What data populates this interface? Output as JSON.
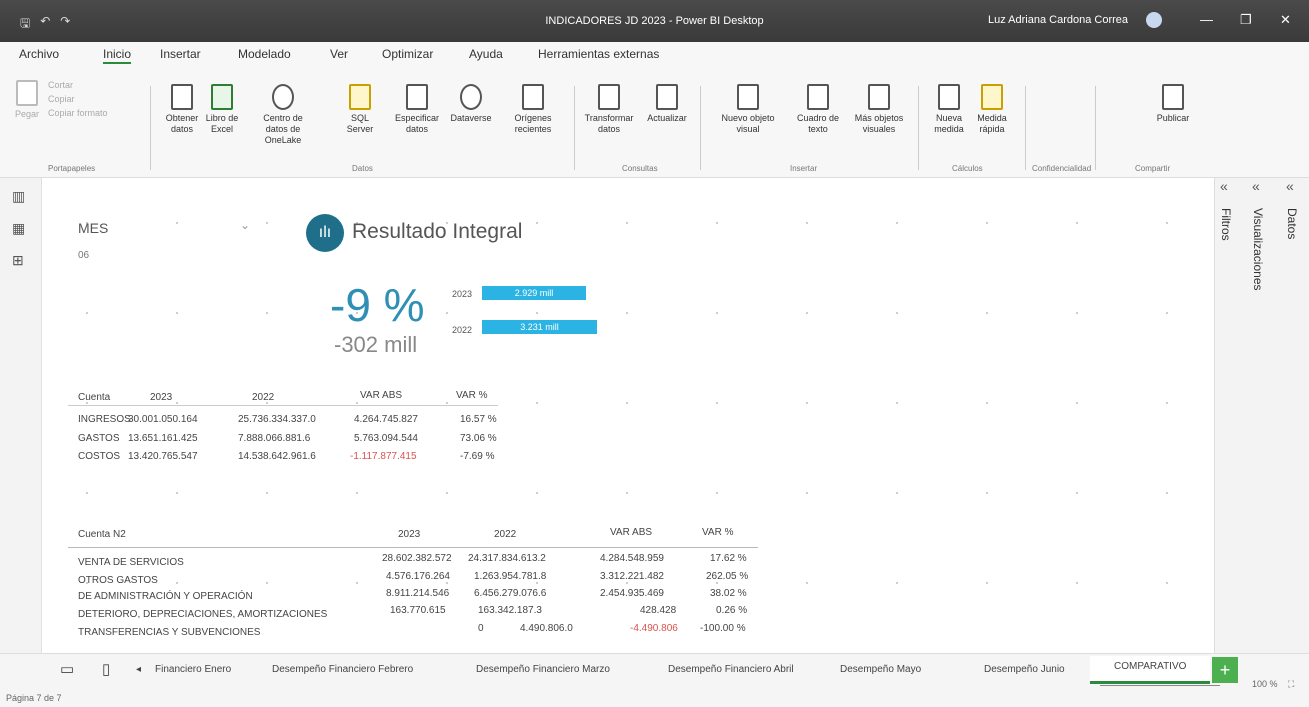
{
  "titlebar": {
    "title": "INDICADORES JD 2023 - Power BI Desktop",
    "user": "Luz Adriana Cardona Correa",
    "minimize": "—",
    "restore": "❐",
    "close": "✕"
  },
  "menu": [
    "Archivo",
    "Inicio",
    "Insertar",
    "Modelado",
    "Ver",
    "Optimizar",
    "Ayuda",
    "Herramientas externas"
  ],
  "ribbon": {
    "clipboard": [
      "Pegar",
      "Cortar",
      "Copiar",
      "Copiar formato"
    ],
    "buttons": [
      "Obtener datos",
      "Libro de Excel",
      "Centro de datos de OneLake",
      "SQL Server",
      "Especificar datos",
      "Dataverse",
      "Orígenes recientes",
      "Transformar datos",
      "Actualizar",
      "Nuevo objeto visual",
      "Cuadro de texto",
      "Más objetos visuales",
      "Nueva medida",
      "Medida rápida",
      "Publicar"
    ],
    "groups": [
      "Portapapeles",
      "Datos",
      "Consultas",
      "Insertar",
      "Cálculos",
      "Confidencialidad",
      "Compartir"
    ]
  },
  "slicer": {
    "label": "MES",
    "value": "06"
  },
  "header": {
    "title": "Resultado Integral"
  },
  "kpi": {
    "pct": "-9 %",
    "abs": "-302 mill",
    "y1": "2023",
    "v1": "2.929 mill",
    "y2": "2022",
    "v2": "3.231 mill"
  },
  "table1": {
    "headers": [
      "Cuenta",
      "2023",
      "2022",
      "VAR ABS",
      "VAR %"
    ],
    "rows": [
      [
        "INGRESOS",
        "30.001.050.164",
        "25.736.334.337.0",
        "4.264.745.827",
        "16.57 %"
      ],
      [
        "GASTOS",
        "13.651.161.425",
        "7.888.066.881.6",
        "5.763.094.544",
        "73.06 %"
      ],
      [
        "COSTOS",
        "13.420.765.547",
        "14.538.642.961.6",
        "-1.117.877.415",
        "-7.69 %"
      ]
    ]
  },
  "table2": {
    "headers": [
      "Cuenta N2",
      "2023",
      "2022",
      "VAR ABS",
      "VAR %"
    ],
    "rows": [
      [
        "VENTA DE SERVICIOS",
        "28.602.382.572",
        "24.317.834.613.2",
        "4.284.548.959",
        "17.62 %"
      ],
      [
        "OTROS GASTOS",
        "4.576.176.264",
        "1.263.954.781.8",
        "3.312.221.482",
        "262.05 %"
      ],
      [
        "DE ADMINISTRACIÓN Y OPERACIÓN",
        "8.911.214.546",
        "6.456.279.076.6",
        "2.454.935.469",
        "38.02 %"
      ],
      [
        "DETERIORO, DEPRECIACIONES, AMORTIZACIONES",
        "163.770.615",
        "163.342.187.3",
        "428.428",
        "0.26 %"
      ],
      [
        "TRANSFERENCIAS Y SUBVENCIONES",
        "0",
        "4.490.806.0",
        "-4.490.806",
        "-100.00 %"
      ]
    ]
  },
  "panes": {
    "filters": "Filtros",
    "visualizations": "Visualizaciones",
    "data": "Datos"
  },
  "tabs": [
    "Financiero Enero",
    "Desempeño Financiero Febrero",
    "Desempeño Financiero Marzo",
    "Desempeño Financiero Abril",
    "Desempeño Mayo",
    "Desempeño Junio",
    "COMPARATIVO"
  ],
  "status": {
    "page": "Página 7 de 7",
    "zoom": "100 %"
  }
}
